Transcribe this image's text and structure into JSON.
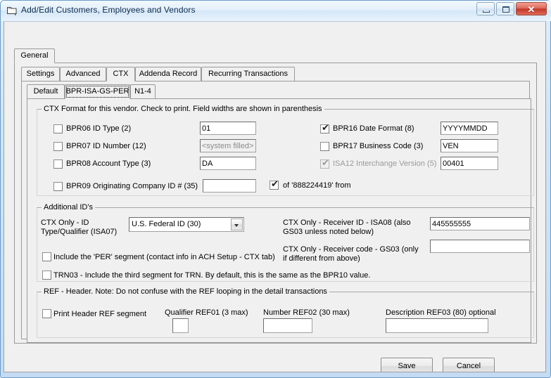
{
  "window": {
    "title": "Add/Edit Customers, Employees and Vendors",
    "icon": "window-folder-icon",
    "minimize_label": "",
    "maximize_label": "",
    "close_label": "✕"
  },
  "tabs_level1": [
    {
      "label": "General",
      "selected": true
    }
  ],
  "tabs_level2": [
    {
      "label": "Settings",
      "selected": false
    },
    {
      "label": "Advanced",
      "selected": false
    },
    {
      "label": "CTX",
      "selected": true
    },
    {
      "label": "Addenda Record",
      "selected": false
    },
    {
      "label": "Recurring Transactions",
      "selected": false
    }
  ],
  "tabs_level3": [
    {
      "label": "Default",
      "selected": false
    },
    {
      "label": "BPR-ISA-GS-PER",
      "selected": true
    },
    {
      "label": "N1-4",
      "selected": false
    }
  ],
  "ctx_group": {
    "title": "CTX Format for this vendor. Check to print. Field widths are shown in parenthesis",
    "left_rows": [
      {
        "label": "BPR06 ID Type (2)",
        "checked": false,
        "value": "01",
        "readonly": false
      },
      {
        "label": "BPR07 ID Number (12)",
        "checked": false,
        "value": "<system filled>",
        "readonly": true
      },
      {
        "label": "BPR08 Account Type (3)",
        "checked": false,
        "value": "DA",
        "readonly": false
      }
    ],
    "originating": {
      "label": "BPR09 Originating Company ID # (35)",
      "checked": false,
      "value": "",
      "of_checked": true,
      "of_label": "of '888224419' from"
    },
    "right_rows": [
      {
        "label": "BPR16 Date Format (8)",
        "checked": true,
        "value": "YYYYMMDD",
        "disabled": false
      },
      {
        "label": "BPR17 Business Code (3)",
        "checked": false,
        "value": "VEN",
        "disabled": false
      },
      {
        "label": "ISA12 Interchange Version (5)",
        "checked": true,
        "value": "00401",
        "disabled": true
      }
    ]
  },
  "additional_group": {
    "title": "Additional ID's",
    "qualifier_label_line1": "CTX Only - ID",
    "qualifier_label_line2": "Type/Qualifier  (ISA07)",
    "qualifier_value": "U.S. Federal ID (30)",
    "qualifier_options": [
      "U.S. Federal ID (30)"
    ],
    "receiver_id_label": "CTX Only - Receiver ID - ISA08 (also GS03 unless noted below)",
    "receiver_id_value": "445555555",
    "receiver_code_label": "CTX Only - Receiver code - GS03 (only if different from above)",
    "receiver_code_value": "",
    "per_checkbox": {
      "label": "Include the 'PER' segment (contact info in ACH Setup - CTX tab)",
      "checked": false
    },
    "trn03_checkbox": {
      "label": "TRN03 - Include the third segment for TRN.  By default, this is the same as the BPR10 value.",
      "checked": false
    }
  },
  "ref_group": {
    "title": "REF - Header.  Note: Do not confuse with the REF looping in the detail transactions",
    "print_checkbox": {
      "label": "Print Header REF segment",
      "checked": false
    },
    "fields": [
      {
        "label": "Qualifier REF01 (3 max)",
        "value": ""
      },
      {
        "label": "Number REF02 (30 max)",
        "value": ""
      },
      {
        "label": "Description REF03 (80) optional",
        "value": ""
      }
    ]
  },
  "footer": {
    "save_label": "Save",
    "cancel_label": "Cancel"
  },
  "colors": {
    "accent": "#c3372a",
    "window_frame": "#cfe4f7",
    "client_bg": "#f0f0f0",
    "disabled_text": "#9a9a9a"
  }
}
